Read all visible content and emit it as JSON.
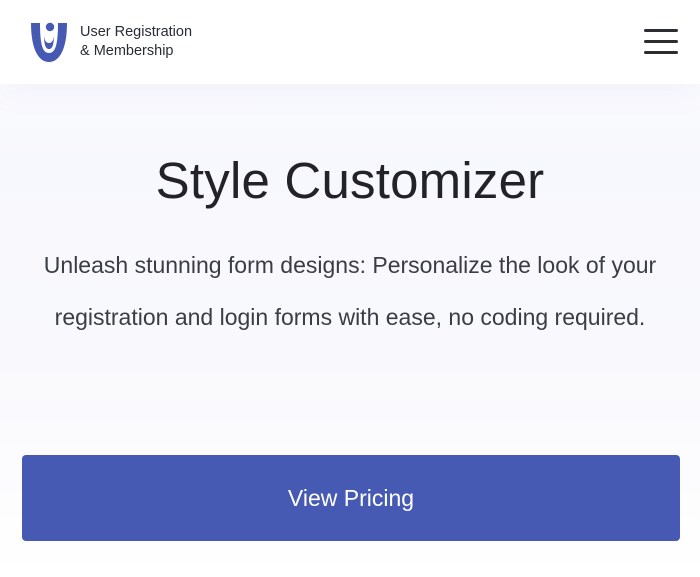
{
  "header": {
    "logo_line1": "User Registration",
    "logo_line2": "& Membership",
    "menu_icon": "hamburger-menu-icon"
  },
  "hero": {
    "title": "Style Customizer",
    "description": "Unleash stunning form designs: Personalize the look of your registration and login forms with ease, no coding required.",
    "cta_label": "View Pricing"
  },
  "colors": {
    "brand": "#4659b3",
    "text_dark": "#222228",
    "text_body": "#3b3d44"
  }
}
